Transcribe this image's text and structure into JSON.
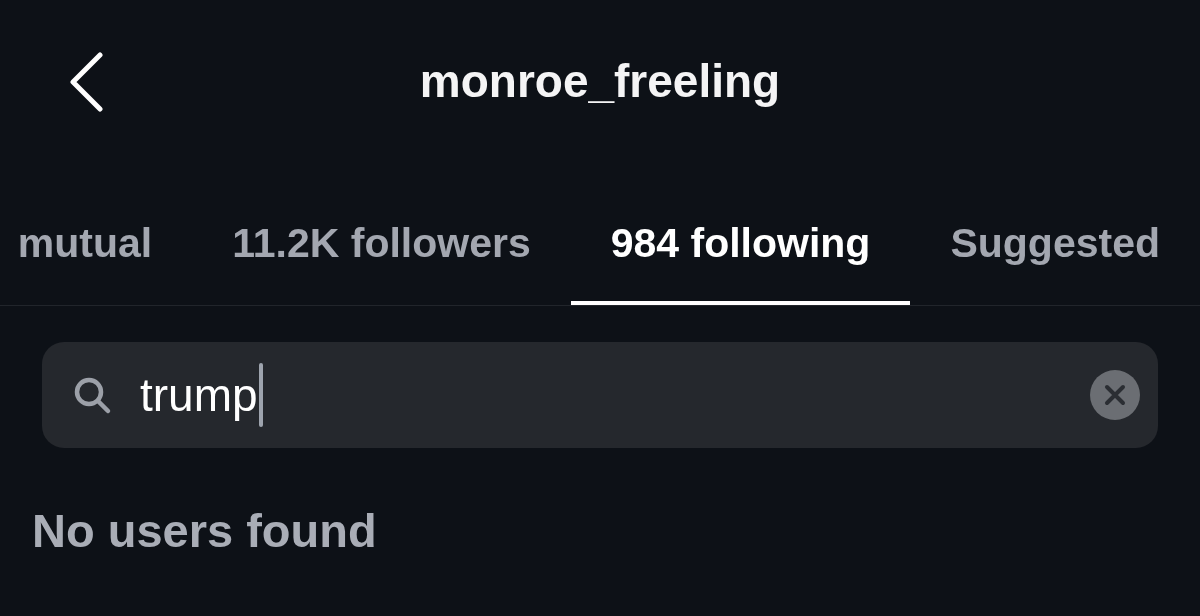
{
  "header": {
    "title": "monroe_freeling"
  },
  "tabs": [
    {
      "label": "mutual",
      "selected": false
    },
    {
      "label": "11.2K followers",
      "selected": false
    },
    {
      "label": "984 following",
      "selected": true
    },
    {
      "label": "Suggested",
      "selected": false
    }
  ],
  "search": {
    "value": "trump",
    "focused": true
  },
  "message": "No users found"
}
